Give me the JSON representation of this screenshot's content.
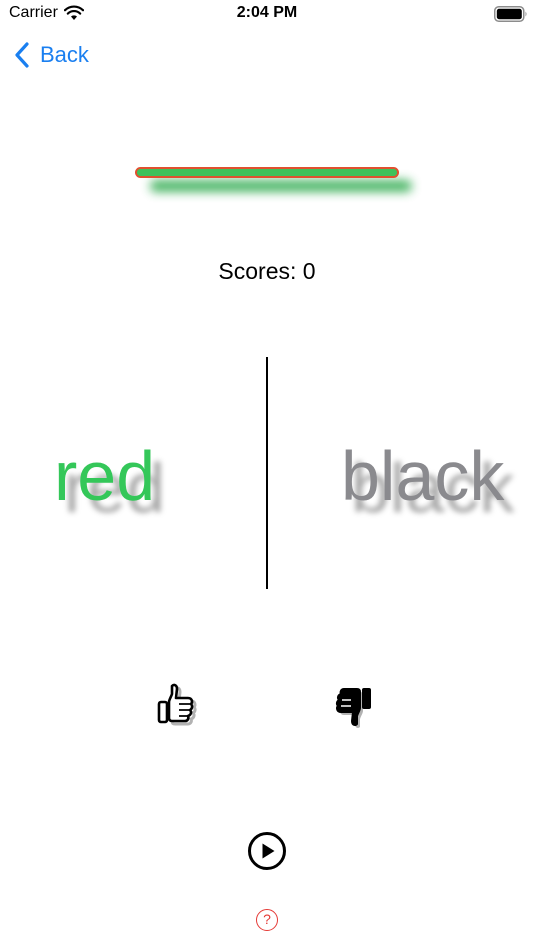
{
  "status_bar": {
    "carrier": "Carrier",
    "time": "2:04 PM",
    "battery_level": 1.0
  },
  "nav": {
    "back_label": "Back"
  },
  "timer": {
    "progress": 1.0,
    "fill_color": "#3ec15a",
    "border_color": "#e0502f"
  },
  "scores": {
    "text": "Scores: 0"
  },
  "words": {
    "left": {
      "text": "red",
      "color": "#34c759"
    },
    "right": {
      "text": "black",
      "color": "#8a8a8e"
    }
  },
  "controls": {
    "agree_icon": "thumbs-up-icon",
    "disagree_icon": "thumbs-down-icon",
    "play_icon": "play-circle-icon",
    "help_label": "?"
  },
  "colors": {
    "accent": "#1a7ff0",
    "help": "#e53935"
  }
}
